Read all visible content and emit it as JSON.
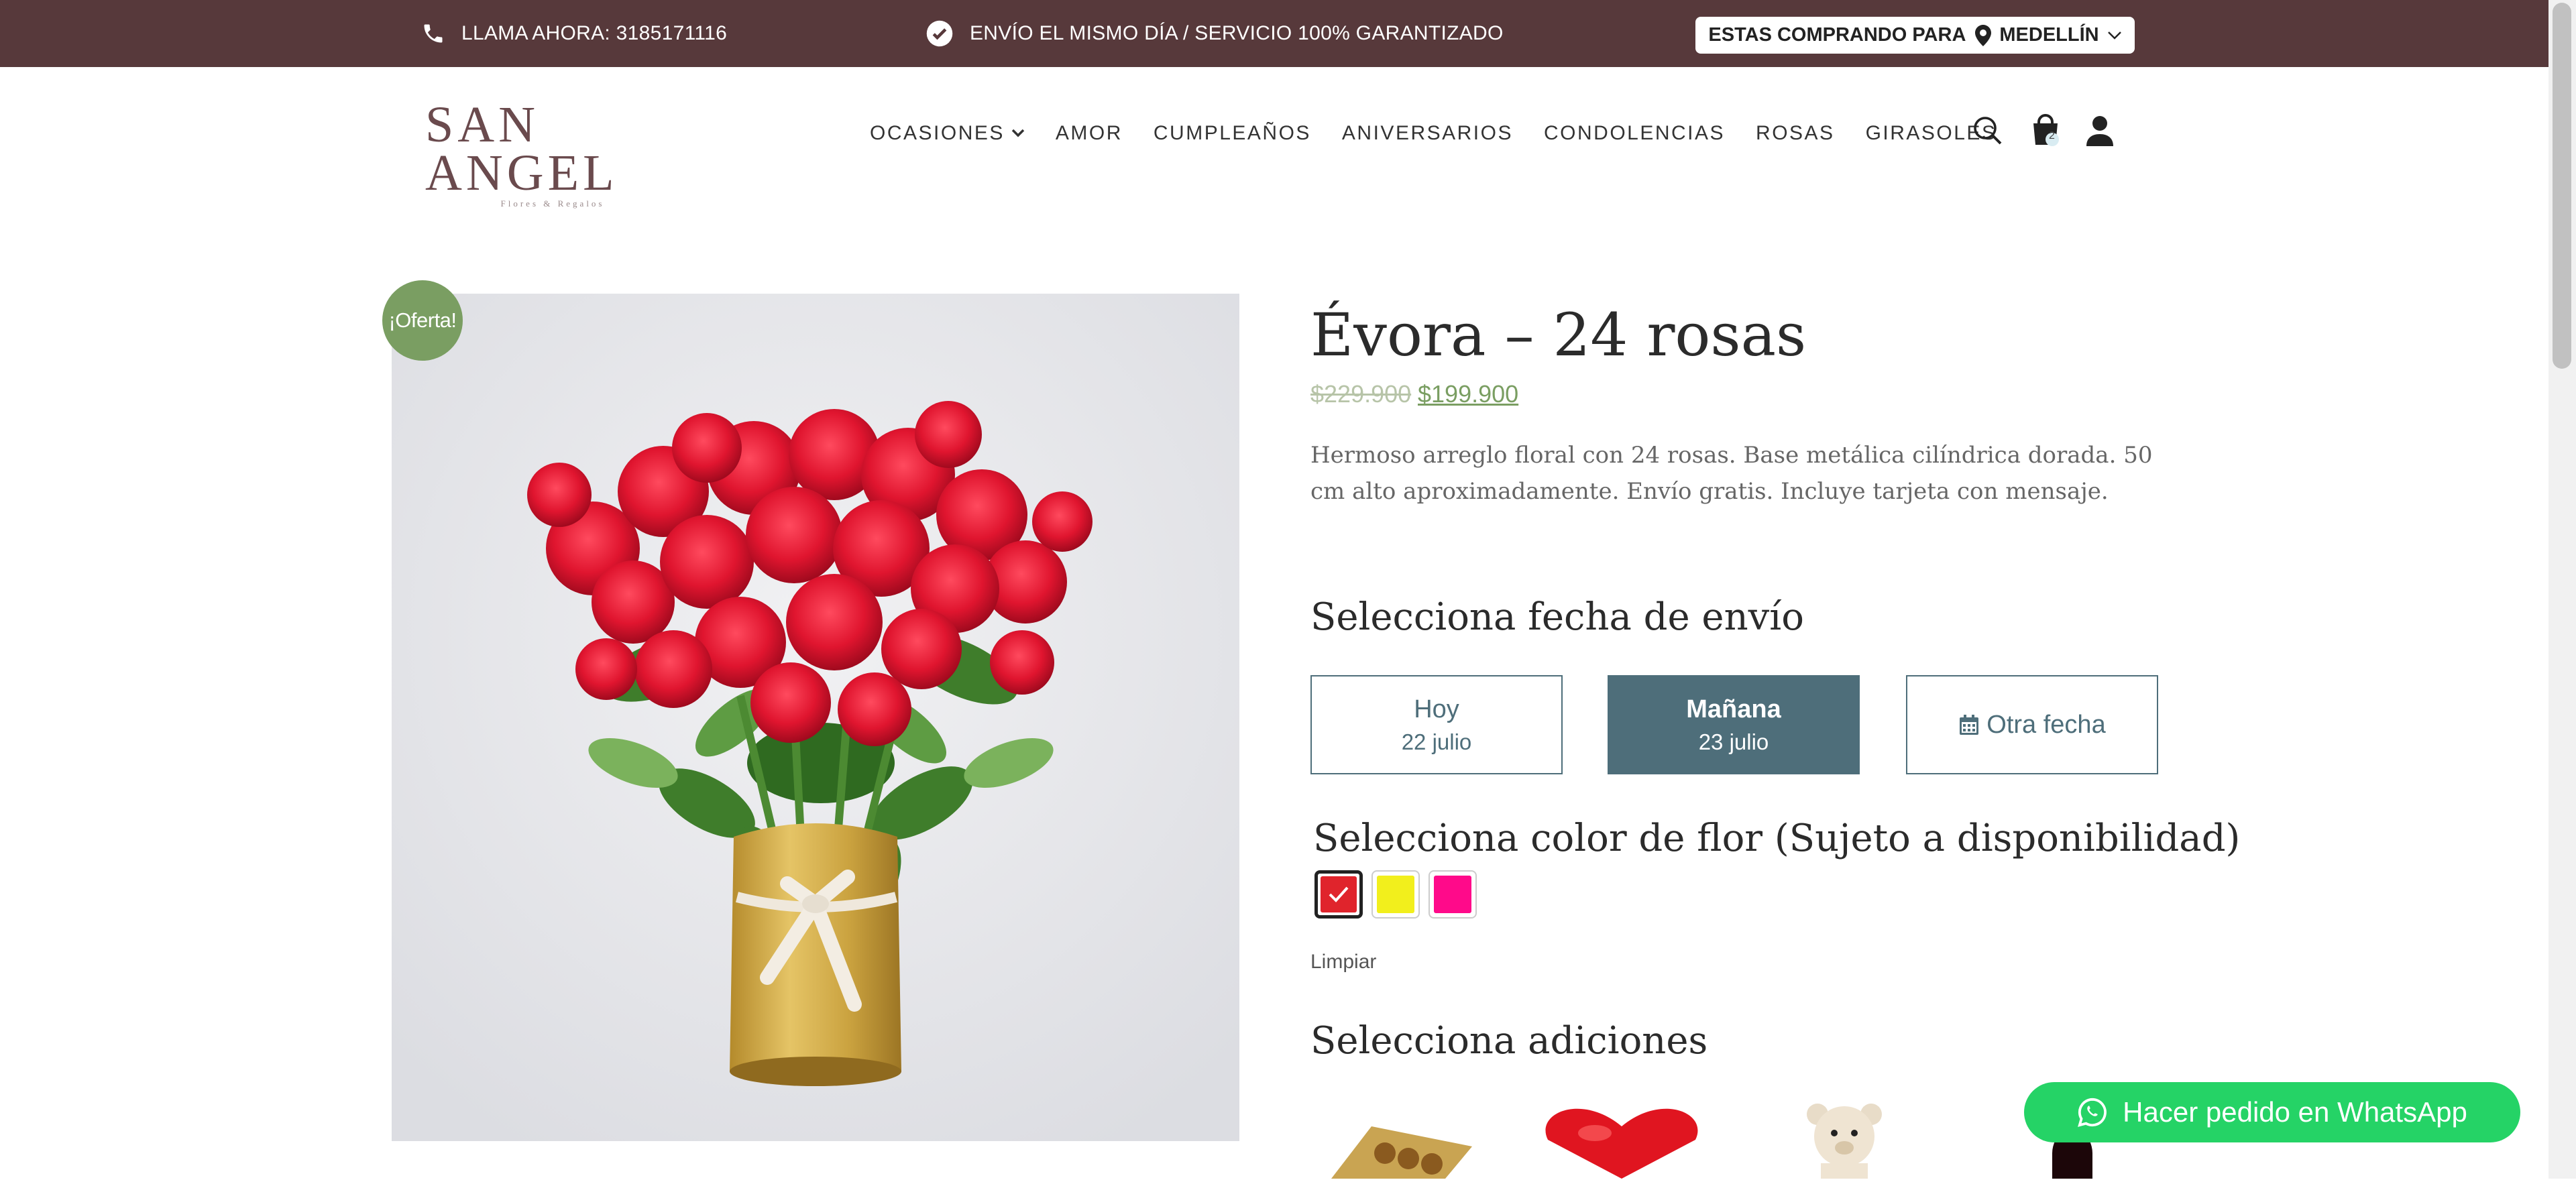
{
  "topbar": {
    "phone_text": "LLAMA AHORA: 3185171116",
    "shipping_text": "ENVÍO EL MISMO DÍA / SERVICIO 100% GARANTIZADO",
    "city_prefix": "ESTAS COMPRANDO PARA",
    "city": "MEDELLÍN",
    "bg_color": "#57393b"
  },
  "header": {
    "logo_text": "SAN ANGEL",
    "logo_sub": "Flores & Regalos",
    "nav": [
      "OCASIONES",
      "AMOR",
      "CUMPLEAÑOS",
      "ANIVERSARIOS",
      "CONDOLENCIAS",
      "ROSAS",
      "GIRASOLES"
    ],
    "cart_count": "2"
  },
  "product": {
    "badge": "¡Oferta!",
    "title": "Évora – 24 rosas",
    "price_old": "$229.900",
    "price_new": "$199.900",
    "description": "Hermoso arreglo floral con 24 rosas. Base metálica cilíndrica dorada. 50 cm alto aproximadamente. Envío gratis. Incluye tarjeta con mensaje.",
    "image_alt": "Ramo de 24 rosas rojas en base dorada"
  },
  "delivery": {
    "heading": "Selecciona fecha de envío",
    "options": [
      {
        "label": "Hoy",
        "sub": "22 julio",
        "active": false
      },
      {
        "label": "Mañana",
        "sub": "23 julio",
        "active": true
      },
      {
        "label": "Otra fecha",
        "sub": "",
        "active": false
      }
    ]
  },
  "color": {
    "heading": "Selecciona color de flor (Sujeto a disponibilidad)",
    "swatches": [
      {
        "name": "rojo",
        "hex": "#e0242c",
        "selected": true
      },
      {
        "name": "amarillo",
        "hex": "#f2ef1c",
        "selected": false
      },
      {
        "name": "fucsia",
        "hex": "#ff0a8a",
        "selected": false
      }
    ],
    "clear_label": "Limpiar"
  },
  "addons": {
    "heading": "Selecciona adiciones",
    "items": [
      "chocolates-icon",
      "heart-balloon-icon",
      "teddy-bear-icon",
      "wine-bottle-icon"
    ]
  },
  "whatsapp": {
    "label": "Hacer pedido en WhatsApp",
    "color": "#25d366"
  }
}
